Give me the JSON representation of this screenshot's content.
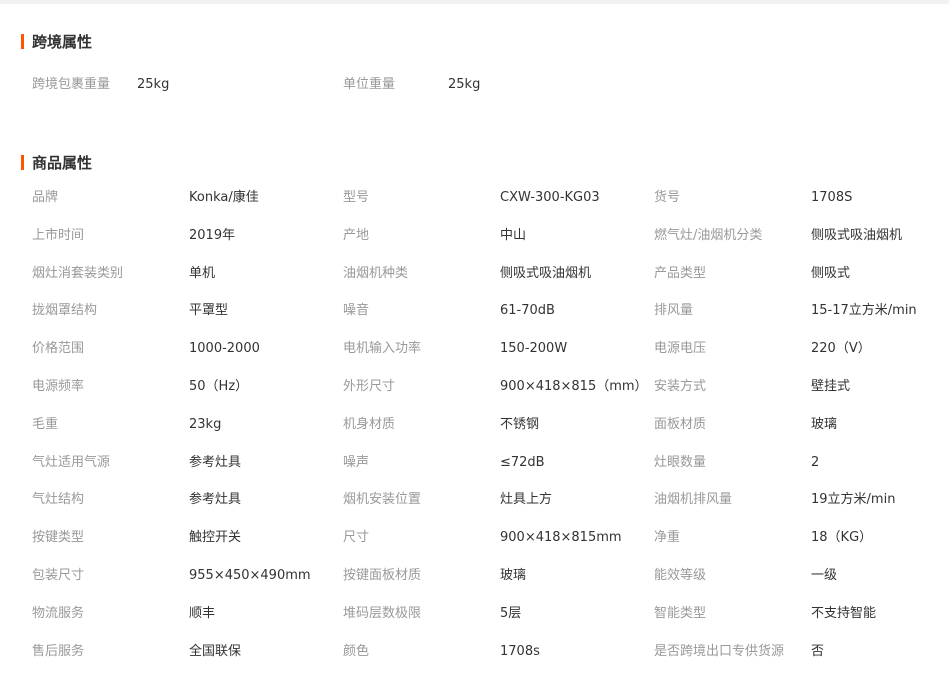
{
  "colors": {
    "accent": "#ff5500",
    "label": "#999999",
    "value": "#333333"
  },
  "cross_border": {
    "title": "跨境属性",
    "rows": [
      {
        "c1_label": "跨境包裹重量",
        "c1_value": "25kg",
        "c2_label": "单位重量",
        "c2_value": "25kg"
      }
    ]
  },
  "product": {
    "title": "商品属性",
    "rows": [
      [
        "品牌",
        "Konka/康佳",
        "型号",
        "CXW-300-KG03",
        "货号",
        "1708S"
      ],
      [
        "上市时间",
        "2019年",
        "产地",
        "中山",
        "燃气灶/油烟机分类",
        "侧吸式吸油烟机"
      ],
      [
        "烟灶消套装类别",
        "单机",
        "油烟机种类",
        "侧吸式吸油烟机",
        "产品类型",
        "侧吸式"
      ],
      [
        "拢烟罩结构",
        "平罩型",
        "噪音",
        "61-70dB",
        "排风量",
        "15-17立方米/min"
      ],
      [
        "价格范围",
        "1000-2000",
        "电机输入功率",
        "150-200W",
        "电源电压",
        "220（V）"
      ],
      [
        "电源频率",
        "50（Hz）",
        "外形尺寸",
        "900×418×815（mm）",
        "安装方式",
        "壁挂式"
      ],
      [
        "毛重",
        "23kg",
        "机身材质",
        "不锈钢",
        "面板材质",
        "玻璃"
      ],
      [
        "气灶适用气源",
        "参考灶具",
        "噪声",
        "≤72dB",
        "灶眼数量",
        "2"
      ],
      [
        "气灶结构",
        "参考灶具",
        "烟机安装位置",
        "灶具上方",
        "油烟机排风量",
        "19立方米/min"
      ],
      [
        "按键类型",
        "触控开关",
        "尺寸",
        "900×418×815mm",
        "净重",
        "18（KG）"
      ],
      [
        "包装尺寸",
        "955×450×490mm",
        "按键面板材质",
        "玻璃",
        "能效等级",
        "一级"
      ],
      [
        "物流服务",
        "顺丰",
        "堆码层数极限",
        "5层",
        "智能类型",
        "不支持智能"
      ],
      [
        "售后服务",
        "全国联保",
        "颜色",
        "1708s",
        "是否跨境出口专供货源",
        "否"
      ]
    ]
  }
}
